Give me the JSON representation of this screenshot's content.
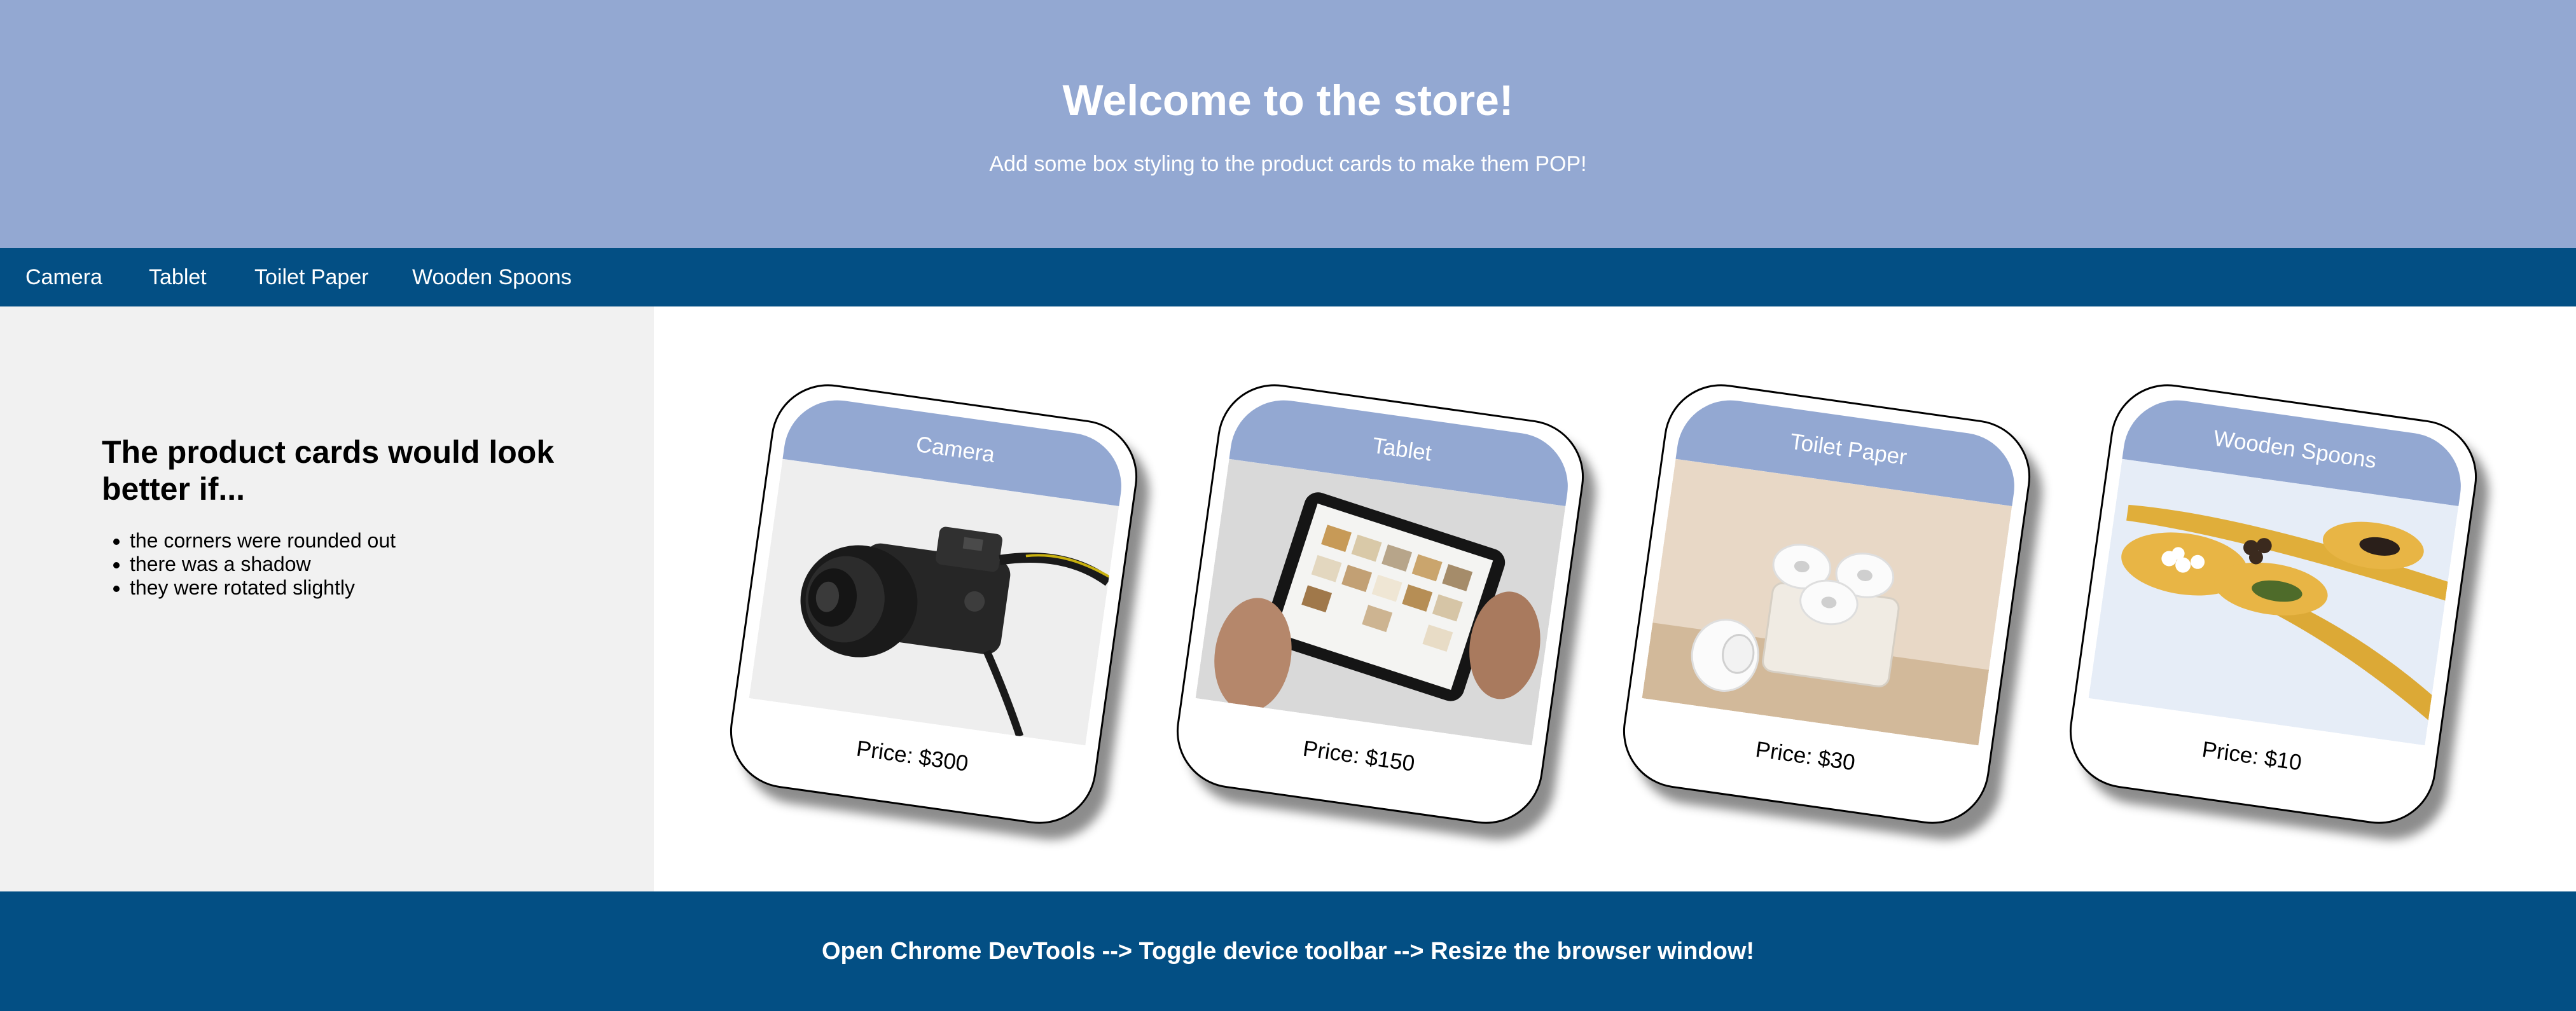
{
  "header": {
    "title": "Welcome to the store!",
    "subtitle": "Add some box styling to the product cards to make them POP!"
  },
  "nav": {
    "items": [
      "Camera",
      "Tablet",
      "Toilet Paper",
      "Wooden Spoons"
    ]
  },
  "sidebar": {
    "heading": "The product cards would look better if...",
    "points": [
      "the corners were rounded out",
      "there was a shadow",
      "they were rotated slightly"
    ]
  },
  "products": [
    {
      "name": "Camera",
      "price": "Price: $300"
    },
    {
      "name": "Tablet",
      "price": "Price: $150"
    },
    {
      "name": "Toilet Paper",
      "price": "Price: $30"
    },
    {
      "name": "Wooden Spoons",
      "price": "Price: $10"
    }
  ],
  "footer": {
    "text": "Open Chrome DevTools --> Toggle device toolbar --> Resize the browser window!"
  },
  "colors": {
    "header_bg": "#93a8d2",
    "nav_bg": "#034f84",
    "sidebar_bg": "#f1f1f1",
    "card_head_bg": "#93a8d2"
  }
}
